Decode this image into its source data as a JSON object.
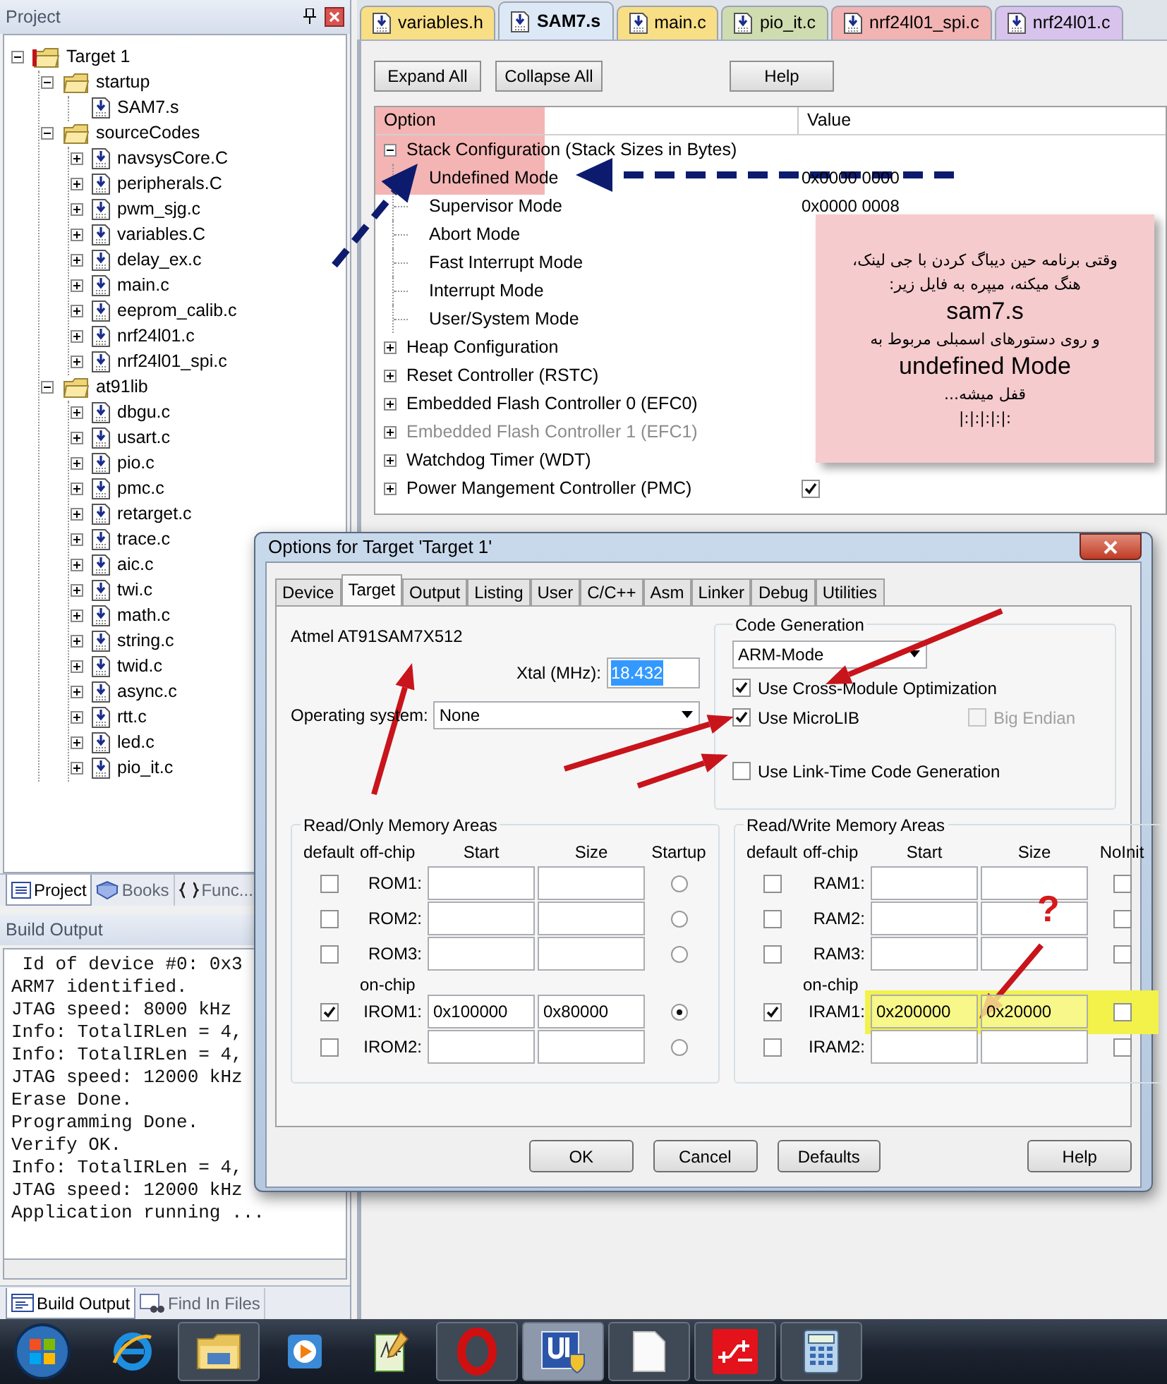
{
  "project_panel": {
    "title": "Project",
    "tree": [
      {
        "label": "Target 1",
        "kind": "target",
        "expanded": true,
        "children": [
          {
            "label": "startup",
            "kind": "group",
            "expanded": true,
            "children": [
              {
                "label": "SAM7.s",
                "kind": "file"
              }
            ]
          },
          {
            "label": "sourceCodes",
            "kind": "group",
            "expanded": true,
            "children": [
              {
                "label": "navsysCore.C",
                "kind": "file",
                "expanded": false
              },
              {
                "label": "peripherals.C",
                "kind": "file",
                "expanded": false
              },
              {
                "label": "pwm_sjg.c",
                "kind": "file",
                "expanded": false
              },
              {
                "label": "variables.C",
                "kind": "file",
                "expanded": false
              },
              {
                "label": "delay_ex.c",
                "kind": "file",
                "expanded": false
              },
              {
                "label": "main.c",
                "kind": "file",
                "expanded": false
              },
              {
                "label": "eeprom_calib.c",
                "kind": "file",
                "expanded": false
              },
              {
                "label": "nrf24l01.c",
                "kind": "file",
                "expanded": false
              },
              {
                "label": "nrf24l01_spi.c",
                "kind": "file",
                "expanded": false
              }
            ]
          },
          {
            "label": "at91lib",
            "kind": "group",
            "expanded": true,
            "children": [
              {
                "label": "dbgu.c",
                "kind": "file",
                "expanded": false
              },
              {
                "label": "usart.c",
                "kind": "file",
                "expanded": false
              },
              {
                "label": "pio.c",
                "kind": "file",
                "expanded": false
              },
              {
                "label": "pmc.c",
                "kind": "file",
                "expanded": false
              },
              {
                "label": "retarget.c",
                "kind": "file",
                "expanded": false
              },
              {
                "label": "trace.c",
                "kind": "file",
                "expanded": false
              },
              {
                "label": "aic.c",
                "kind": "file",
                "expanded": false
              },
              {
                "label": "twi.c",
                "kind": "file",
                "expanded": false
              },
              {
                "label": "math.c",
                "kind": "file",
                "expanded": false
              },
              {
                "label": "string.c",
                "kind": "file",
                "expanded": false
              },
              {
                "label": "twid.c",
                "kind": "file",
                "expanded": false
              },
              {
                "label": "async.c",
                "kind": "file",
                "expanded": false
              },
              {
                "label": "rtt.c",
                "kind": "file",
                "expanded": false
              },
              {
                "label": "led.c",
                "kind": "file",
                "expanded": false
              },
              {
                "label": "pio_it.c",
                "kind": "file",
                "expanded": false
              }
            ]
          }
        ]
      }
    ],
    "tabs": [
      {
        "label": "Project",
        "kind": "project",
        "selected": true
      },
      {
        "label": "Books",
        "kind": "books",
        "selected": false
      },
      {
        "label": "Func...",
        "kind": "functions",
        "selected": false
      }
    ]
  },
  "build_output": {
    "title": "Build Output",
    "lines": [
      " Id of device #0: 0x3",
      "ARM7 identified.",
      "JTAG speed: 8000 kHz",
      "Info: TotalIRLen = 4,",
      "Info: TotalIRLen = 4,",
      "JTAG speed: 12000 kHz",
      "Erase Done.",
      "Programming Done.",
      "Verify OK.",
      "Info: TotalIRLen = 4,",
      "JTAG speed: 12000 kHz",
      "Application running ..."
    ],
    "tabs": [
      {
        "label": "Build Output",
        "kind": "output",
        "selected": true
      },
      {
        "label": "Find In Files",
        "kind": "find",
        "selected": false
      }
    ]
  },
  "editor_tabs": [
    {
      "label": "variables.h",
      "selected": false,
      "color": "#f8de85"
    },
    {
      "label": "SAM7.s",
      "selected": true,
      "color": "#dce8f6"
    },
    {
      "label": "main.c",
      "selected": false,
      "color": "#f8de85"
    },
    {
      "label": "pio_it.c",
      "selected": false,
      "color": "#cfdcb0"
    },
    {
      "label": "nrf24l01_spi.c",
      "selected": false,
      "color": "#f2b3b3"
    },
    {
      "label": "nrf24l01.c",
      "selected": false,
      "color": "#d7c3ec"
    }
  ],
  "config_wizard": {
    "buttons": [
      "Expand All",
      "Collapse All",
      "Help"
    ],
    "columns": [
      "Option",
      "Value"
    ],
    "rows": [
      {
        "label": "Stack Configuration (Stack Sizes in Bytes)",
        "expanded": true,
        "disabled": false,
        "children": [
          {
            "label": "Undefined Mode",
            "value": "0x0000 0000"
          },
          {
            "label": "Supervisor Mode",
            "value": "0x0000 0008"
          },
          {
            "label": "Abort Mode"
          },
          {
            "label": "Fast Interrupt Mode"
          },
          {
            "label": "Interrupt Mode"
          },
          {
            "label": "User/System Mode"
          }
        ]
      },
      {
        "label": "Heap Configuration",
        "expanded": false,
        "disabled": false
      },
      {
        "label": "Reset Controller (RSTC)",
        "expanded": false,
        "disabled": false
      },
      {
        "label": "Embedded Flash Controller 0 (EFC0)",
        "expanded": false,
        "disabled": false
      },
      {
        "label": "Embedded Flash Controller 1 (EFC1)",
        "expanded": false,
        "disabled": true
      },
      {
        "label": "Watchdog Timer (WDT)",
        "expanded": false,
        "disabled": false
      },
      {
        "label": "Power Mangement Controller (PMC)",
        "expanded": false,
        "disabled": false,
        "checked": true
      }
    ]
  },
  "note": {
    "lines": [
      {
        "text": "وقتی برنامه حین دیباگ کردن با جی لینک،",
        "kind": "persian"
      },
      {
        "text": "هنگ میکنه، میپره به فایل زیر:",
        "kind": "persian"
      },
      {
        "text": "sam7.s",
        "kind": "latin"
      },
      {
        "text": "و روی دستورهای اسمبلی مربوط به",
        "kind": "persian"
      },
      {
        "text": "undefined Mode",
        "kind": "latin"
      },
      {
        "text": "قفل میشه...",
        "kind": "persian"
      },
      {
        "text": ":|:|:|:|:|",
        "kind": "persian"
      }
    ]
  },
  "dialog": {
    "title": "Options for Target 'Target 1'",
    "tabs": [
      {
        "label": "Device",
        "selected": false
      },
      {
        "label": "Target",
        "selected": true
      },
      {
        "label": "Output",
        "selected": false
      },
      {
        "label": "Listing",
        "selected": false
      },
      {
        "label": "User",
        "selected": false
      },
      {
        "label": "C/C++",
        "selected": false
      },
      {
        "label": "Asm",
        "selected": false
      },
      {
        "label": "Linker",
        "selected": false
      },
      {
        "label": "Debug",
        "selected": false
      },
      {
        "label": "Utilities",
        "selected": false
      }
    ],
    "device": "Atmel AT91SAM7X512",
    "xtal": {
      "label": "Xtal (MHz):",
      "value": "18.432"
    },
    "os": {
      "label": "Operating system:",
      "value": "None"
    },
    "code_generation": {
      "title": "Code Generation",
      "mode": "ARM-Mode",
      "options": [
        {
          "label": "Use Cross-Module Optimization",
          "checked": true,
          "disabled": false
        },
        {
          "label": "Use MicroLIB",
          "checked": true,
          "disabled": false
        },
        {
          "label": "Big Endian",
          "checked": false,
          "disabled": true
        },
        {
          "label": "Use Link-Time Code Generation",
          "checked": false,
          "disabled": false
        }
      ]
    },
    "memory_areas": [
      {
        "title": "Read/Only Memory Areas",
        "kind": "rom",
        "columns": [
          "default",
          "off-chip",
          "Start",
          "Size",
          "Startup"
        ],
        "rows": [
          {
            "kind": "area",
            "label": "ROM1:",
            "default": false,
            "selected": false,
            "highlighted": false
          },
          {
            "kind": "area",
            "label": "ROM2:",
            "default": false,
            "selected": false,
            "highlighted": false
          },
          {
            "kind": "area",
            "label": "ROM3:",
            "default": false,
            "selected": false,
            "highlighted": false
          },
          {
            "kind": "caption",
            "label": "on-chip"
          },
          {
            "kind": "area",
            "label": "IROM1:",
            "default": true,
            "start": "0x100000",
            "size": "0x80000",
            "selected": true,
            "highlighted": false
          },
          {
            "kind": "area",
            "label": "IROM2:",
            "default": false,
            "selected": false,
            "highlighted": false
          }
        ]
      },
      {
        "title": "Read/Write Memory Areas",
        "kind": "ram",
        "columns": [
          "default",
          "off-chip",
          "Start",
          "Size",
          "NoInit"
        ],
        "rows": [
          {
            "kind": "area",
            "label": "RAM1:",
            "default": false,
            "noinit": false,
            "highlighted": false
          },
          {
            "kind": "area",
            "label": "RAM2:",
            "default": false,
            "noinit": false,
            "highlighted": false
          },
          {
            "kind": "area",
            "label": "RAM3:",
            "default": false,
            "noinit": false,
            "highlighted": false
          },
          {
            "kind": "caption",
            "label": "on-chip"
          },
          {
            "kind": "area",
            "label": "IRAM1:",
            "default": true,
            "start": "0x200000",
            "size": "0x20000",
            "noinit": false,
            "highlighted": true
          },
          {
            "kind": "area",
            "label": "IRAM2:",
            "default": false,
            "noinit": false,
            "highlighted": false
          }
        ]
      }
    ],
    "buttons": [
      "OK",
      "Cancel",
      "Defaults",
      "Help"
    ],
    "question_mark": "?"
  },
  "taskbar": [
    {
      "kind": "start",
      "running": false,
      "selected": false
    },
    {
      "kind": "browser",
      "running": false,
      "selected": false
    },
    {
      "kind": "explorer",
      "running": true,
      "selected": false
    },
    {
      "kind": "media",
      "running": false,
      "selected": false
    },
    {
      "kind": "notepad",
      "running": false,
      "selected": false
    },
    {
      "kind": "opera",
      "running": true,
      "selected": false
    },
    {
      "kind": "ide",
      "running": true,
      "selected": true
    },
    {
      "kind": "document",
      "running": true,
      "selected": false
    },
    {
      "kind": "tool",
      "running": true,
      "selected": false
    },
    {
      "kind": "calculator",
      "running": true,
      "selected": false
    }
  ]
}
